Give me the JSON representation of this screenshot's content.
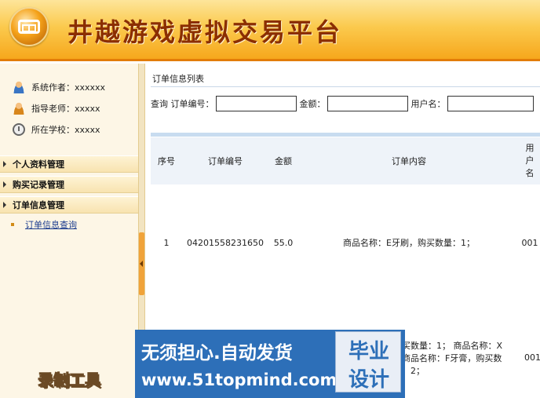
{
  "header": {
    "title": "井越游戏虚拟交易平台"
  },
  "sidebar": {
    "info": [
      {
        "label": "系统作者：xxxxxx",
        "icon": "user-icon"
      },
      {
        "label": "指导老师：xxxxx",
        "icon": "teacher-icon"
      },
      {
        "label": "所在学校：xxxxx",
        "icon": "school-icon"
      }
    ],
    "menus": [
      {
        "label": "个人资料管理"
      },
      {
        "label": "购买记录管理"
      },
      {
        "label": "订单信息管理"
      }
    ],
    "submenu": {
      "label": "订单信息查询"
    }
  },
  "main": {
    "section_title": "订单信息列表",
    "search": {
      "query_label": "查询",
      "order_no_label": "订单编号：",
      "amount_label": "金额：",
      "username_label": "用户名："
    },
    "table": {
      "headers": {
        "seq": "序号",
        "order_no": "订单编号",
        "amount": "金额",
        "content": "订单内容",
        "user_l1": "用",
        "user_l2": "户",
        "user_l3": "名"
      },
      "rows": [
        {
          "seq": "1",
          "order_no": "04201558231650",
          "amount": "55.0",
          "content": "商品名称：E牙刷，购买数量：1；",
          "user": "001"
        }
      ]
    },
    "row2": {
      "content_l1": "买数量：1； 商品名称：X",
      "content_l2": "商品名称：F牙膏，购买数",
      "content_l3": "：2；",
      "user": "001"
    }
  },
  "overlay": {
    "banner_line1": "无须担心.自动发货",
    "banner_line2": "www.51topmind.com",
    "badge_line1": "毕业",
    "badge_line2": "设计",
    "record_label": "录制工具"
  }
}
